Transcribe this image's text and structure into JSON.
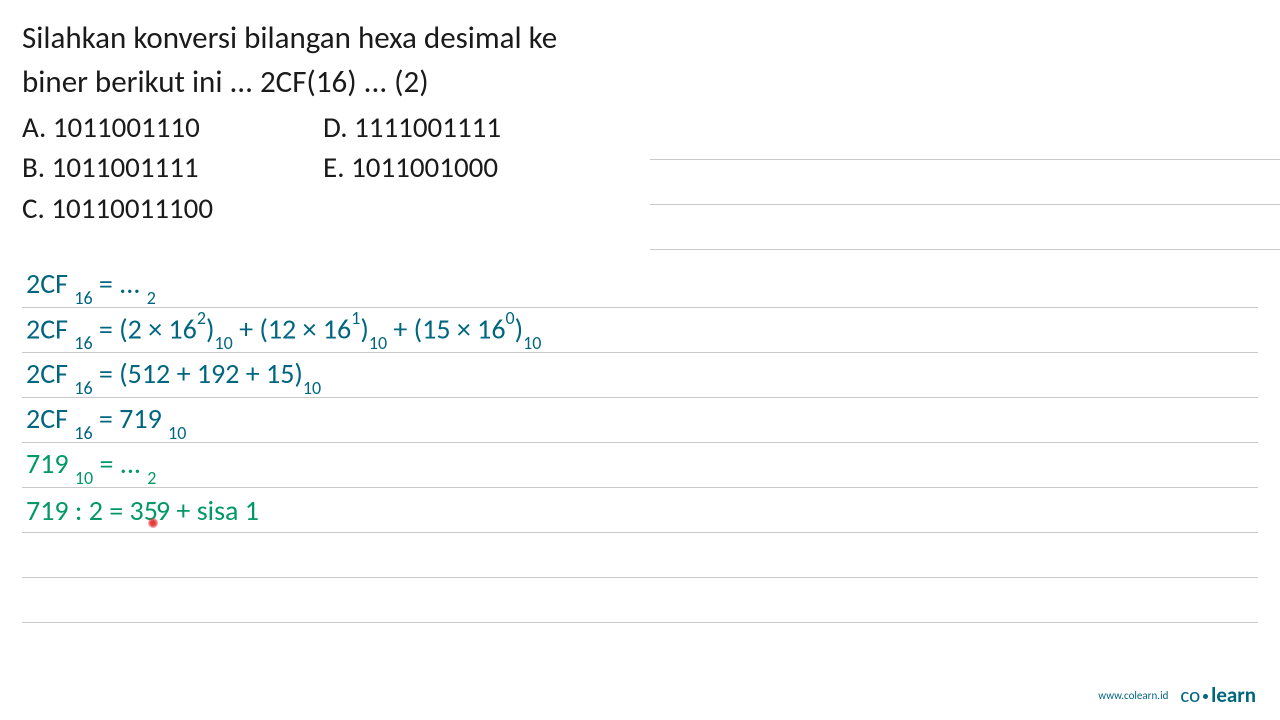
{
  "question": {
    "line1": "Silahkan konversi bilangan hexa desimal ke",
    "line2": "biner berikut ini ... 2CF(16) ... (2)"
  },
  "options": {
    "a": "A.  1011001110",
    "b": "B.  1011001111",
    "c": "C.  10110011100",
    "d": "D.  1111001111",
    "e": "E.  1011001000"
  },
  "work": {
    "l1_pre": "2CF ",
    "l1_sub": "16",
    "l1_post": " = ... ",
    "l1_sub2": "2",
    "l2_pre": "2CF ",
    "l2_sub": "16",
    "l2_a": " = (2 × 16",
    "l2_sup1": "2",
    "l2_b": ")",
    "l2_sub10a": "10",
    "l2_c": " + (12 × 16",
    "l2_sup2": "1",
    "l2_d": ")",
    "l2_sub10b": "10",
    "l2_e": " + (15 × 16",
    "l2_sup3": "0",
    "l2_f": ")",
    "l2_sub10c": "10",
    "l3_pre": "2CF ",
    "l3_sub": "16",
    "l3_post": " = (512 + 192 + 15)",
    "l3_sub2": "10",
    "l4_pre": "2CF ",
    "l4_sub": "16",
    "l4_mid": " = 719 ",
    "l4_sub2": "10",
    "l5_pre": "719 ",
    "l5_sub": "10",
    "l5_post": " = ... ",
    "l5_sub2": "2",
    "l6_a": "719 : 2 = 35",
    "l6_b": "9 + sisa 1"
  },
  "footer": {
    "url": "www.colearn.id",
    "brand_co": "co",
    "brand_learn": "learn"
  },
  "chart_data": {
    "type": "table",
    "description": "Math worksheet showing hexadecimal to binary conversion of 2CF(16)",
    "question": "Convert hexadecimal 2CF to binary",
    "options": [
      "1011001110",
      "1011001111",
      "10110011100",
      "1111001111",
      "1011001000"
    ],
    "working_steps": [
      "2CF_16 = ..._2",
      "2CF_16 = (2 × 16^2)_10 + (12 × 16^1)_10 + (15 × 16^0)_10",
      "2CF_16 = (512 + 192 + 15)_10",
      "2CF_16 = 719_10",
      "719_10 = ..._2",
      "719 : 2 = 359 + sisa 1"
    ]
  }
}
